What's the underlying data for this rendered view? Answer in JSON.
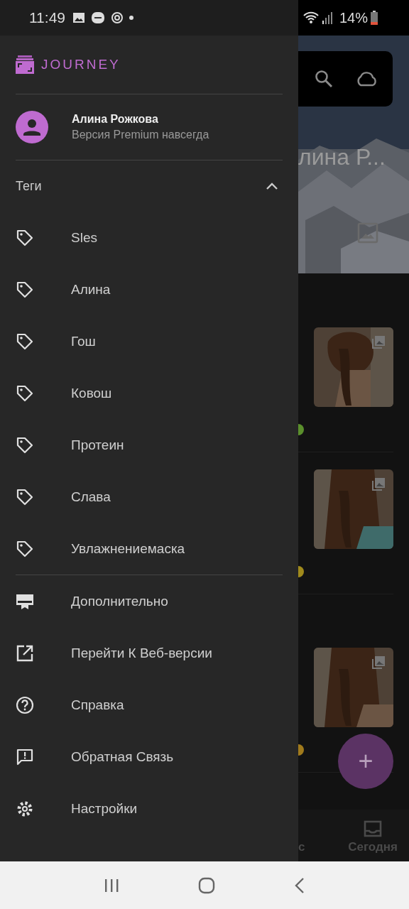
{
  "status_bar": {
    "time": "11:49",
    "battery": "14%"
  },
  "drawer": {
    "app_name": "JOURNEY",
    "user": {
      "name": "Алина Рожкова",
      "subtitle": "Версия Premium навсегда"
    },
    "tags": {
      "title": "Теги",
      "expanded": true,
      "items": [
        {
          "label": "Sles"
        },
        {
          "label": "Алина"
        },
        {
          "label": "Гош"
        },
        {
          "label": "Ковош"
        },
        {
          "label": "Протеин"
        },
        {
          "label": "Слава"
        },
        {
          "label": "Увлажнениемаска"
        }
      ]
    },
    "items": [
      {
        "kind": "more",
        "label": "Дополнительно"
      },
      {
        "kind": "web",
        "label": "Перейти К Веб-версии"
      },
      {
        "kind": "help",
        "label": "Справка"
      },
      {
        "kind": "feedback",
        "label": "Обратная Связь"
      },
      {
        "kind": "settings",
        "label": "Настройки"
      }
    ]
  },
  "background": {
    "title": "лина Р...",
    "entries": [
      {
        "color": "#5a8f2c"
      },
      {
        "color": "#a08a1c"
      },
      {
        "color": "#a07a1c"
      }
    ],
    "fab": "+",
    "bottom_nav": [
      {
        "label": "с",
        "kind": "text"
      },
      {
        "label": "Сегодня",
        "kind": "inbox"
      }
    ]
  }
}
